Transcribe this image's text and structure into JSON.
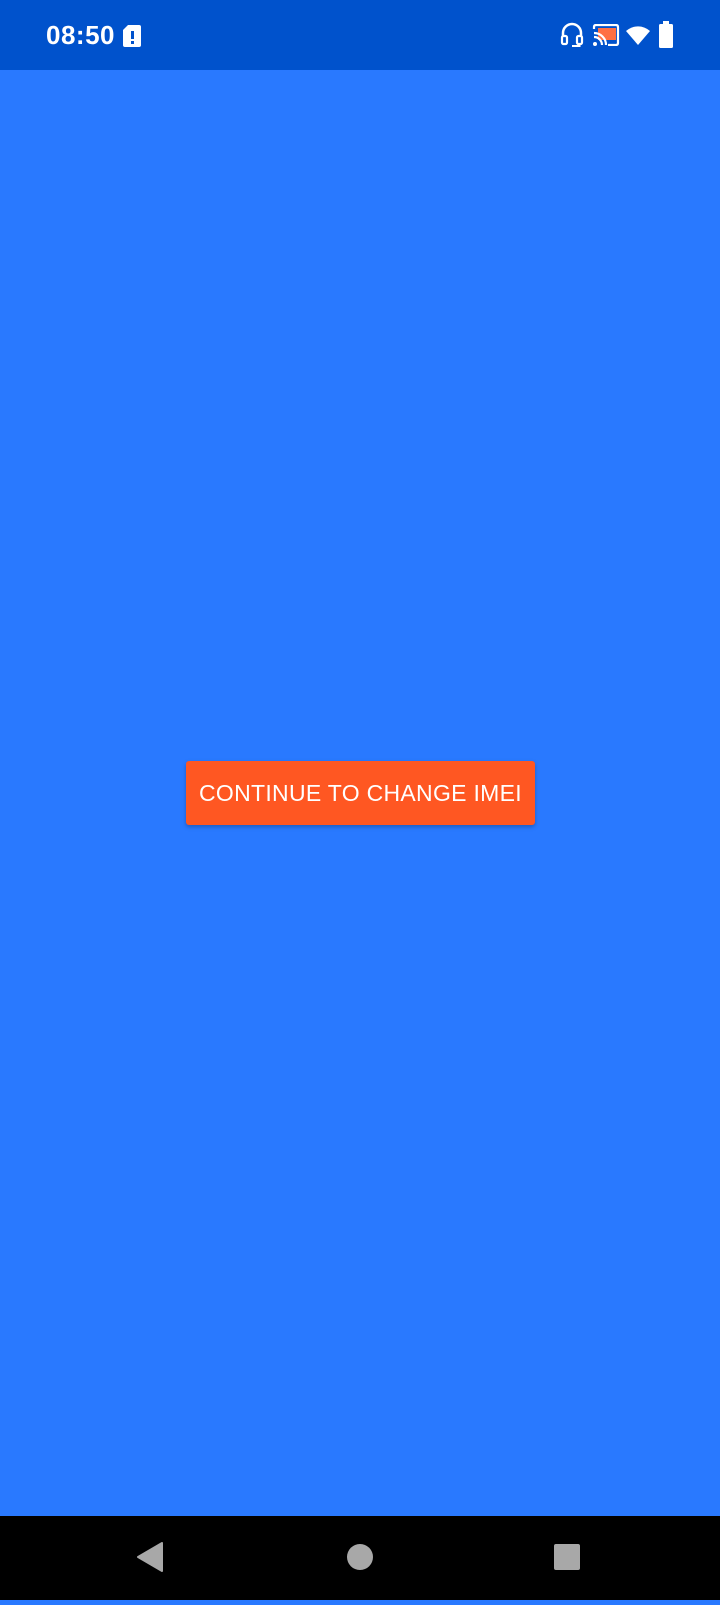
{
  "status_bar": {
    "time": "08:50",
    "icons": [
      "sim-alert-icon",
      "headset-icon",
      "cast-icon",
      "wifi-icon",
      "battery-icon"
    ],
    "background_color": "#0052CC"
  },
  "main": {
    "background_color": "#2979FF",
    "continue_button": {
      "label": "CONTINUE TO CHANGE IMEI",
      "color": "#FF5722"
    }
  },
  "nav_bar": {
    "buttons": [
      "back-icon",
      "home-icon",
      "recents-icon"
    ],
    "background_color": "#000000"
  }
}
